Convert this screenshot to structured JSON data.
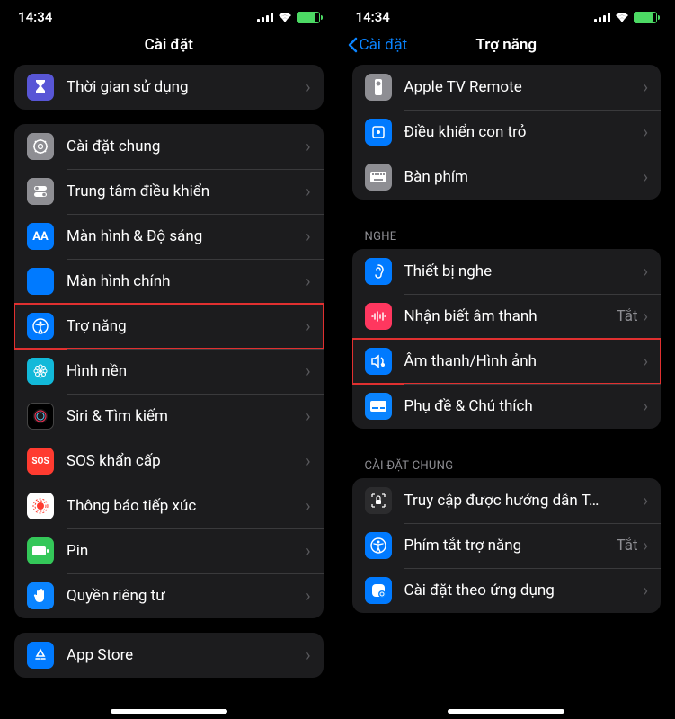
{
  "status": {
    "time": "14:34"
  },
  "left": {
    "title": "Cài đặt",
    "groups": [
      {
        "rows": [
          {
            "id": "screentime",
            "label": "Thời gian sử dụng"
          }
        ]
      },
      {
        "rows": [
          {
            "id": "general",
            "label": "Cài đặt chung"
          },
          {
            "id": "control-center",
            "label": "Trung tâm điều khiển"
          },
          {
            "id": "display",
            "label": "Màn hình & Độ sáng"
          },
          {
            "id": "home-screen",
            "label": "Màn hình chính"
          },
          {
            "id": "accessibility",
            "label": "Trợ năng",
            "highlight": true
          },
          {
            "id": "wallpaper",
            "label": "Hình nền"
          },
          {
            "id": "siri",
            "label": "Siri & Tìm kiếm"
          },
          {
            "id": "sos",
            "label": "SOS khẩn cấp"
          },
          {
            "id": "exposure",
            "label": "Thông báo tiếp xúc"
          },
          {
            "id": "battery",
            "label": "Pin"
          },
          {
            "id": "privacy",
            "label": "Quyền riêng tư"
          }
        ]
      },
      {
        "rows": [
          {
            "id": "appstore",
            "label": "App Store"
          }
        ]
      }
    ]
  },
  "right": {
    "back": "Cài đặt",
    "title": "Trợ năng",
    "groups": [
      {
        "rows": [
          {
            "id": "tv-remote",
            "label": "Apple TV Remote"
          },
          {
            "id": "pointer",
            "label": "Điều khiển con trỏ"
          },
          {
            "id": "keyboard",
            "label": "Bàn phím"
          }
        ]
      },
      {
        "header": "NGHE",
        "rows": [
          {
            "id": "hearing",
            "label": "Thiết bị nghe"
          },
          {
            "id": "sound-recognition",
            "label": "Nhận biết âm thanh",
            "value": "Tắt"
          },
          {
            "id": "audio-visual",
            "label": "Âm thanh/Hình ảnh",
            "highlight": true
          },
          {
            "id": "subtitles",
            "label": "Phụ đề & Chú thích"
          }
        ]
      },
      {
        "header": "CÀI ĐẶT CHUNG",
        "rows": [
          {
            "id": "guided-access",
            "label": "Truy cập được hướng dẫn T…"
          },
          {
            "id": "shortcut",
            "label": "Phím tắt trợ năng",
            "value": "Tắt"
          },
          {
            "id": "per-app",
            "label": "Cài đặt theo ứng dụng"
          }
        ]
      }
    ]
  }
}
